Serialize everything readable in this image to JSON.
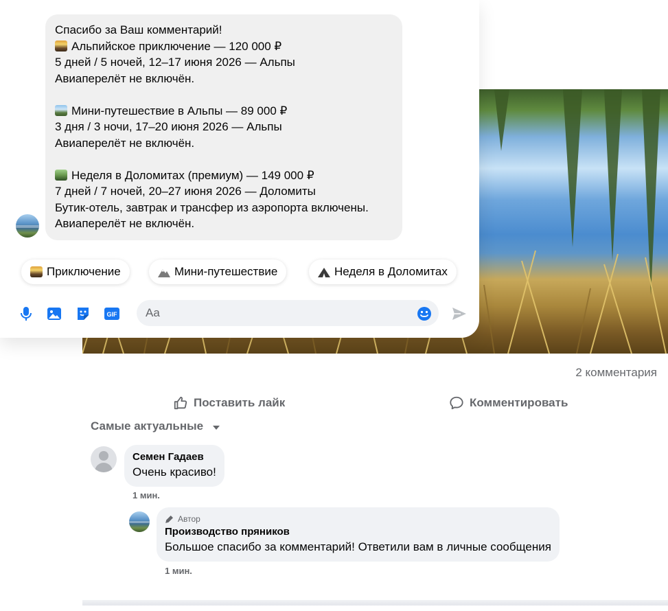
{
  "chat": {
    "bot_message": {
      "greeting": "Спасибо за Ваш комментарий!",
      "offers": [
        {
          "icon": "sunset-emoji",
          "title": "Альпийское приключение — 120 000 ₽",
          "dates": "5 дней / 5 ночей, 12–17 июня 2026 — Альпы",
          "notes": [
            "Авиаперелёт не включён."
          ]
        },
        {
          "icon": "mountain-emoji",
          "title": "Мини-путешествие в Альпы — 89 000 ₽",
          "dates": "3 дня / 3 ночи, 17–20 июня 2026 — Альпы",
          "notes": [
            "Авиаперелёт не включён."
          ]
        },
        {
          "icon": "tent-emoji",
          "title": "Неделя в Доломитах (премиум) — 149 000 ₽",
          "dates": "7 дней / 7 ночей, 20–27 июня 2026 — Доломиты",
          "notes": [
            "Бутик-отель, завтрак и трансфер из аэропорта включены.",
            "Авиаперелёт не включён."
          ]
        }
      ]
    },
    "quick_replies": [
      {
        "icon": "sunset-emoji",
        "label": "Приключение"
      },
      {
        "icon": "mountain-emoji",
        "label": "Мини-путешествие"
      },
      {
        "icon": "tent-emoji",
        "label": "Неделя в Доломитах"
      }
    ],
    "composer": {
      "placeholder": "Aa",
      "icons": [
        "microphone-icon",
        "image-icon",
        "sticker-icon",
        "gif-icon",
        "emoji-icon",
        "send-icon"
      ],
      "gif_label": "GIF"
    }
  },
  "post": {
    "comments_count": "2 комментария",
    "like_label": "Поставить лайк",
    "comment_label": "Комментировать",
    "sort_label": "Самые актуальные"
  },
  "comments": [
    {
      "author": "Семен Гадаев",
      "text": "Очень красиво!",
      "time": "1 мин.",
      "replies": [
        {
          "badge": "Автор",
          "author": "Производство пряников",
          "text": "Большое спасибо за комментарий! Ответили вам в личные сообщения",
          "time": "1 мин."
        }
      ]
    }
  ],
  "colors": {
    "accent": "#1877f2",
    "secondary_text": "#65676b",
    "bubble_bg": "#f0f0f0",
    "send_disabled": "#bcc0c4"
  }
}
